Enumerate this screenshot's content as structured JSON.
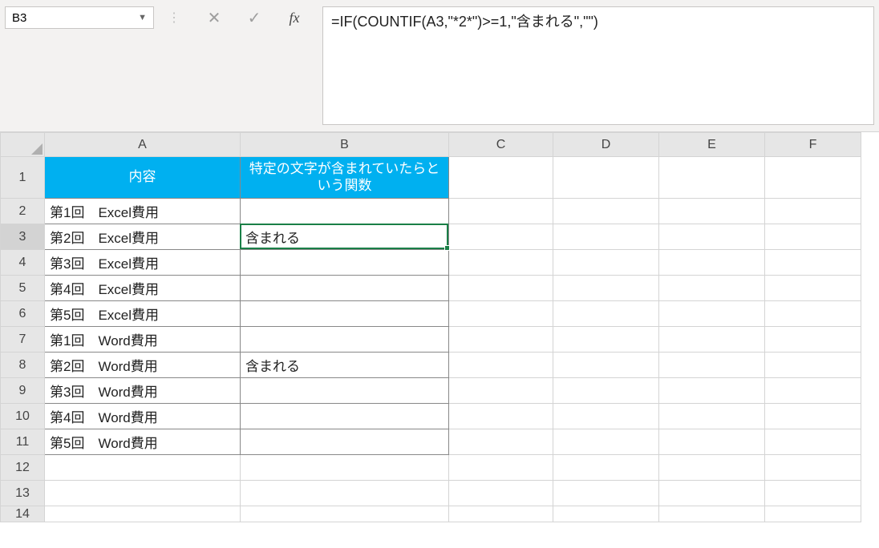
{
  "nameBox": "B3",
  "formula": "=IF(COUNTIF(A3,\"*2*\")>=1,\"含まれる\",\"\")",
  "columns": [
    "A",
    "B",
    "C",
    "D",
    "E",
    "F"
  ],
  "headerRow": {
    "A": "内容",
    "B": "特定の文字が含まれていたらという関数"
  },
  "rows": [
    {
      "n": 2,
      "A": "第1回　Excel費用",
      "B": ""
    },
    {
      "n": 3,
      "A": "第2回　Excel費用",
      "B": "含まれる"
    },
    {
      "n": 4,
      "A": "第3回　Excel費用",
      "B": ""
    },
    {
      "n": 5,
      "A": "第4回　Excel費用",
      "B": ""
    },
    {
      "n": 6,
      "A": "第5回　Excel費用",
      "B": ""
    },
    {
      "n": 7,
      "A": "第1回　Word費用",
      "B": ""
    },
    {
      "n": 8,
      "A": "第2回　Word費用",
      "B": "含まれる"
    },
    {
      "n": 9,
      "A": "第3回　Word費用",
      "B": ""
    },
    {
      "n": 10,
      "A": "第4回　Word費用",
      "B": ""
    },
    {
      "n": 11,
      "A": "第5回　Word費用",
      "B": ""
    }
  ],
  "emptyRows": [
    12,
    13,
    14
  ],
  "selectedCell": "B3"
}
